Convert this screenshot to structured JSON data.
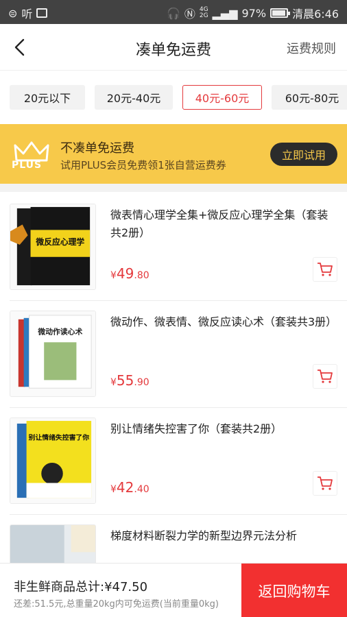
{
  "status_bar": {
    "left_text": "听",
    "network_top": "4G",
    "network_bottom": "2G",
    "battery_percent": 97,
    "battery_text": "97%",
    "time": "清晨6:46"
  },
  "nav": {
    "title": "凑单免运费",
    "right_link": "运费规则"
  },
  "filters": [
    {
      "label": "20元以下",
      "active": false
    },
    {
      "label": "20元-40元",
      "active": false
    },
    {
      "label": "40元-60元",
      "active": true
    },
    {
      "label": "60元-80元",
      "active": false
    }
  ],
  "plus_banner": {
    "logo_text": "PLUS",
    "title": "不凑单免运费",
    "subtitle": "试用PLUS会员免费领1张自营运费券",
    "button": "立即试用"
  },
  "products": [
    {
      "title": "微表情心理学全集+微反应心理学全集（套装共2册）",
      "price_currency": "¥",
      "price_int": "49",
      "price_dec": ".80",
      "cover_text": "微反应心理学"
    },
    {
      "title": "微动作、微表情、微反应读心术（套装共3册）",
      "price_currency": "¥",
      "price_int": "55",
      "price_dec": ".90",
      "cover_text": "微动作读心术"
    },
    {
      "title": "别让情绪失控害了你（套装共2册）",
      "price_currency": "¥",
      "price_int": "42",
      "price_dec": ".40",
      "cover_text": "别让情绪失控害了你"
    },
    {
      "title": "梯度材料断裂力学的新型边界元法分析",
      "price_currency": "",
      "price_int": "",
      "price_dec": "",
      "cover_text": ""
    }
  ],
  "bottom": {
    "total": "非生鲜商品总计:¥47.50",
    "hint": "还差:51.5元,总重量20kg内可免运费(当前重量0kg)",
    "button": "返回购物车"
  },
  "colors": {
    "accent": "#e4393c",
    "banner": "#f7c94a",
    "button_dark": "#2b2b2b",
    "checkout": "#f23030"
  }
}
